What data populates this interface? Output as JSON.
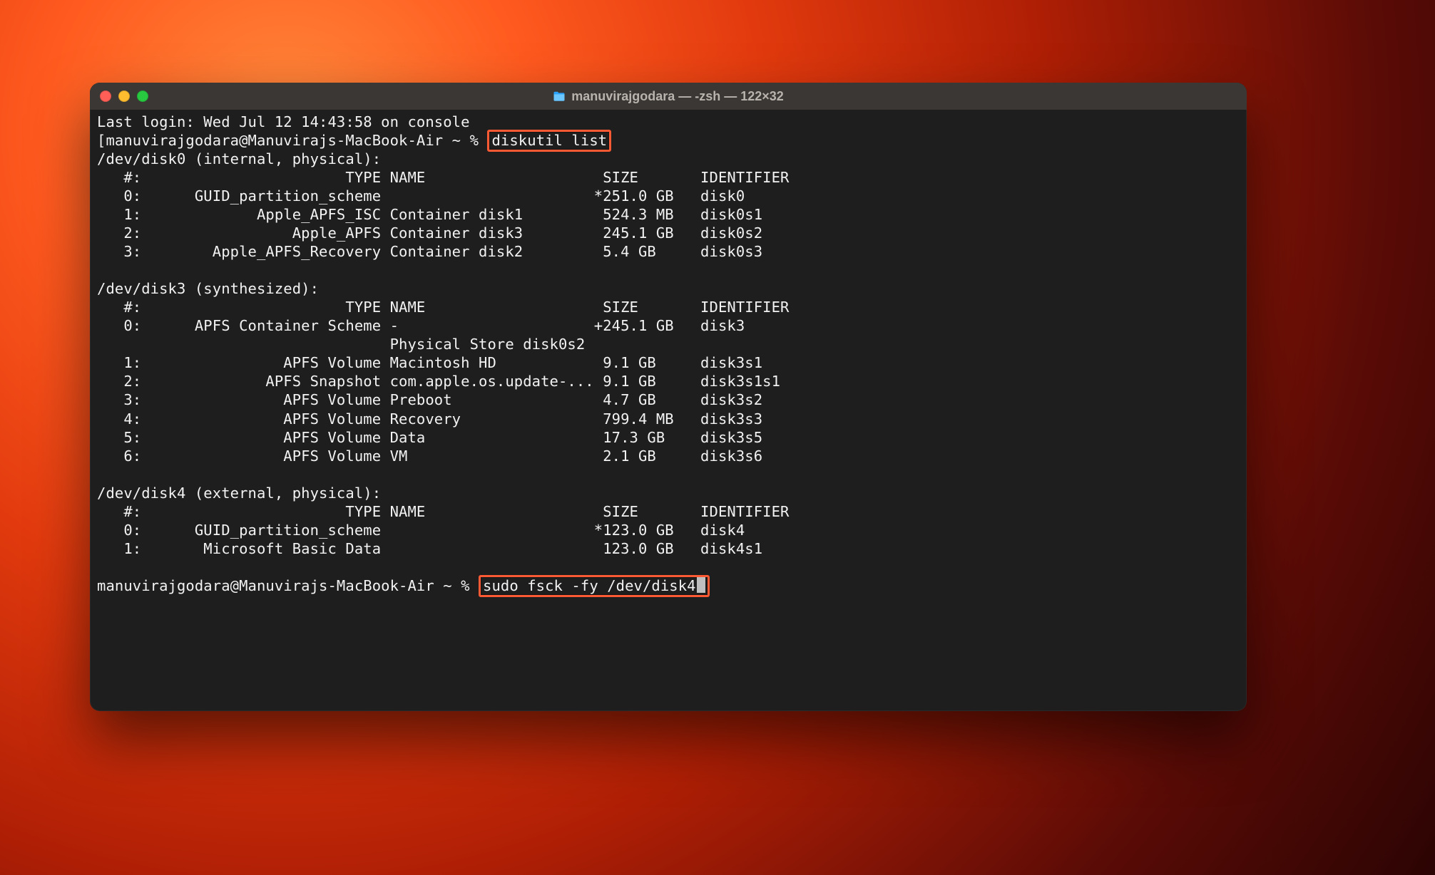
{
  "window": {
    "title": "manuvirajgodara — -zsh — 122×32"
  },
  "session": {
    "last_login": "Last login: Wed Jul 12 14:43:58 on console",
    "prompt1_prefix": "[manuvirajgodara@Manuvirajs-MacBook-Air ~ % ",
    "cmd1": "diskutil list",
    "prompt2_prefix": "manuvirajgodara@Manuvirajs-MacBook-Air ~ % ",
    "cmd2": "sudo fsck -fy /dev/disk4"
  },
  "disks": {
    "disk0": {
      "header": "/dev/disk0 (internal, physical):",
      "columns": "   #:                       TYPE NAME                    SIZE       IDENTIFIER",
      "rows": [
        "   0:      GUID_partition_scheme                        *251.0 GB   disk0",
        "   1:             Apple_APFS_ISC Container disk1         524.3 MB   disk0s1",
        "   2:                 Apple_APFS Container disk3         245.1 GB   disk0s2",
        "   3:        Apple_APFS_Recovery Container disk2         5.4 GB     disk0s3"
      ]
    },
    "disk3": {
      "header": "/dev/disk3 (synthesized):",
      "columns": "   #:                       TYPE NAME                    SIZE       IDENTIFIER",
      "rows": [
        "   0:      APFS Container Scheme -                      +245.1 GB   disk3",
        "                                 Physical Store disk0s2",
        "   1:                APFS Volume Macintosh HD            9.1 GB     disk3s1",
        "   2:              APFS Snapshot com.apple.os.update-... 9.1 GB     disk3s1s1",
        "   3:                APFS Volume Preboot                 4.7 GB     disk3s2",
        "   4:                APFS Volume Recovery                799.4 MB   disk3s3",
        "   5:                APFS Volume Data                    17.3 GB    disk3s5",
        "   6:                APFS Volume VM                      2.1 GB     disk3s6"
      ]
    },
    "disk4": {
      "header": "/dev/disk4 (external, physical):",
      "columns": "   #:                       TYPE NAME                    SIZE       IDENTIFIER",
      "rows": [
        "   0:      GUID_partition_scheme                        *123.0 GB   disk4",
        "   1:       Microsoft Basic Data                         123.0 GB   disk4s1"
      ]
    }
  }
}
